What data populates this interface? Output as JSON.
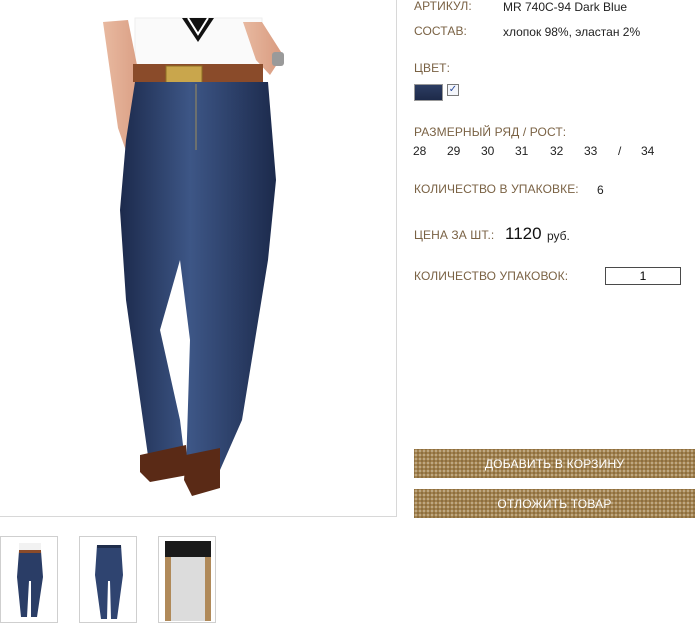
{
  "product": {
    "article_label": "АРТИКУЛ:",
    "article_value": "MR 740C-94 Dark Blue",
    "composition_label": "СОСТАВ:",
    "composition_value": "хлопок 98%, эластан 2%",
    "color_label": "ЦВЕТ:",
    "color_swatch": "#25345a",
    "color_checked": true,
    "size_label": "РАЗМЕРНЫЙ РЯД / РОСТ:",
    "sizes": [
      "28",
      "29",
      "30",
      "31",
      "32",
      "33",
      "/",
      "34"
    ],
    "pack_qty_label": "КОЛИЧЕСТВО В УПАКОВКЕ:",
    "pack_qty_value": "6",
    "price_label": "ЦЕНА ЗА ШТ.:",
    "price_value": "1120",
    "price_unit": "руб.",
    "packs_label": "КОЛИЧЕСТВО УПАКОВОК:",
    "packs_value": "1"
  },
  "buttons": {
    "add_to_cart": "ДОБАВИТЬ В КОРЗИНУ",
    "postpone": "ОТЛОЖИТЬ ТОВАР"
  },
  "images": {
    "main": "jeans-front-photo",
    "thumbnails": [
      "jeans-front-thumb",
      "jeans-back-thumb",
      "fabric-inside-thumb"
    ]
  },
  "colors": {
    "label_brown": "#7a6244",
    "button_gold": "#a2824f",
    "denim": "#2a3d66"
  }
}
